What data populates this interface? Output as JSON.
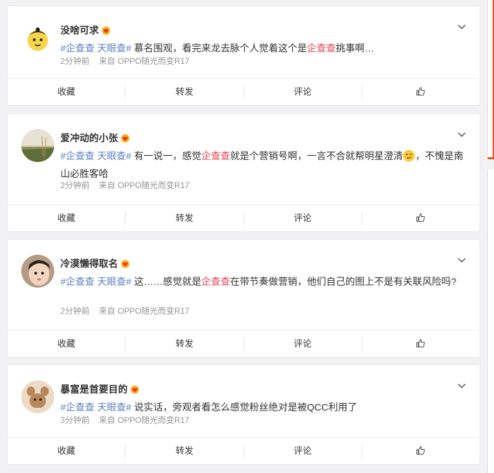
{
  "posts": [
    {
      "name": "没啥可求",
      "tags": [
        "#企查查",
        "天眼查#"
      ],
      "text_before": " 慕名围观，看完来龙去脉个人觉着这个是",
      "highlight": "企查查",
      "text_after": "挑事啊…",
      "time": "2分钟前",
      "source": "来自 OPPO随光而变R17"
    },
    {
      "name": "爱冲动的小张",
      "tags": [
        "#企查查",
        "天眼查#"
      ],
      "text_before": " 有一说一，感觉",
      "highlight": "企查查",
      "text_after": "就是个营销号啊，一言不合就帮明星澄清",
      "text_end": "，不愧是南山必胜客哈",
      "time": "2分钟前",
      "source": "来自 OPPO随光而变R17"
    },
    {
      "name": "冷漠懒得取名",
      "tags": [
        "#企查查",
        "天眼查#"
      ],
      "text_before": " 这……感觉就是",
      "highlight": "企查查",
      "text_after": "在带节奏做营销，他们自己的图上不是有关联风险吗?",
      "time": "2分钟前",
      "source": "来自 OPPO随光而变R17"
    },
    {
      "name": "暴富是首要目的",
      "tags": [
        "#企查查",
        "天眼查#"
      ],
      "text_before": " 说实话，旁观者看怎么感觉粉丝绝对是被QCC利用了",
      "time": "3分钟前",
      "source": "来自 OPPO随光而变R17"
    }
  ],
  "actions": {
    "favorite": "收藏",
    "repost": "转发",
    "comment": "评论"
  },
  "icons": {
    "badge": "crown-heart-badge-icon",
    "chevron": "chevron-down-icon",
    "like": "thumbs-up-icon",
    "emoji": "smirk-emoji-icon"
  },
  "colors": {
    "tag": "#5b7fc2",
    "highlight": "#e0454f",
    "accent": "#f0541e"
  }
}
